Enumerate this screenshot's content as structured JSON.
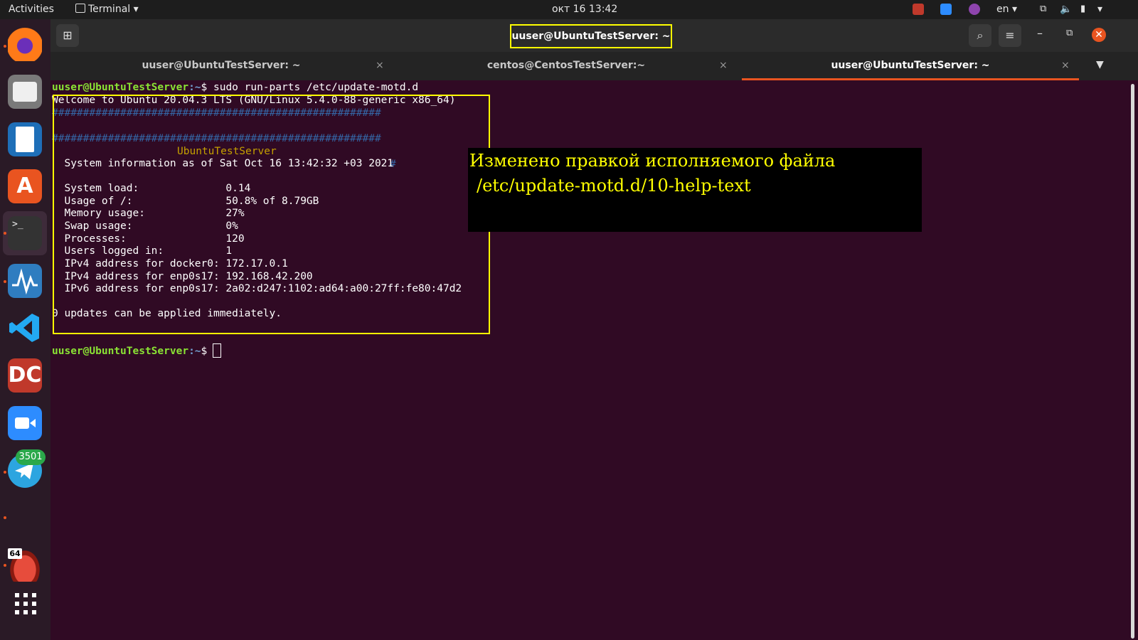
{
  "topbar": {
    "activities": "Activities",
    "app_name": "Terminal",
    "datetime": "окт 16  13:42",
    "lang": "en"
  },
  "dock": {
    "telegram_badge": "3501",
    "app64_badge": "64"
  },
  "window": {
    "title": "uuser@UbuntuTestServer: ~"
  },
  "tabs": [
    {
      "label": "uuser@UbuntuTestServer: ~",
      "close": "×"
    },
    {
      "label": "centos@CentosTestServer:~",
      "close": "×"
    },
    {
      "label": "uuser@UbuntuTestServer: ~",
      "close": "×"
    }
  ],
  "terminal": {
    "prompt_user": "uuser@UbuntuTestServer",
    "prompt_path": ":~",
    "command": "$ sudo run-parts /etc/update-motd.d",
    "welcome": "Welcome to Ubuntu 20.04.3 LTS (GNU/Linux 5.4.0-88-generic x86_64)",
    "hash_line": "#####################################################",
    "banner_left": "#",
    "banner_name": "UbuntuTestServer",
    "banner_right": "#",
    "sysinfo": "  System information as of Sat Oct 16 13:42:32 +03 2021",
    "stats": [
      "  System load:              0.14",
      "  Usage of /:               50.8% of 8.79GB",
      "  Memory usage:             27%",
      "  Swap usage:               0%",
      "  Processes:                120",
      "  Users logged in:          1",
      "  IPv4 address for docker0: 172.17.0.1",
      "  IPv4 address for enp0s17: 192.168.42.200",
      "  IPv6 address for enp0s17: 2a02:d247:1102:ad64:a00:27ff:fe80:47d2"
    ],
    "updates": "0 updates can be applied immediately.",
    "prompt2_symbol": "$"
  },
  "annotation": {
    "line1": "Изменено правкой исполняемого файла",
    "line2": "/etc/update-motd.d/10-help-text"
  }
}
